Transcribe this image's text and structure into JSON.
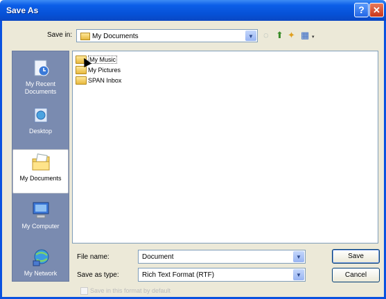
{
  "window": {
    "title": "Save As",
    "help_icon": "?",
    "close_icon": "✕"
  },
  "toolbar": {
    "save_in_label": "Save in:",
    "save_in_value": "My Documents",
    "back_icon": "back-icon",
    "up_icon": "up-folder-icon",
    "new_folder_icon": "new-folder-icon",
    "views_icon": "views-menu-icon",
    "back_glyph": "◌",
    "up_glyph": "⬆",
    "new_folder_glyph": "✦",
    "views_glyph": "▦"
  },
  "places": [
    {
      "label": "My Recent Documents",
      "icon": "recent-documents-icon"
    },
    {
      "label": "Desktop",
      "icon": "desktop-icon"
    },
    {
      "label": "My Documents",
      "icon": "my-documents-icon",
      "selected": true
    },
    {
      "label": "My Computer",
      "icon": "my-computer-icon"
    },
    {
      "label": "My Network",
      "icon": "my-network-icon"
    }
  ],
  "files": [
    {
      "name": "My Music"
    },
    {
      "name": "My Pictures"
    },
    {
      "name": "SPAN Inbox"
    }
  ],
  "form": {
    "file_name_label": "File name:",
    "file_name_value": "Document",
    "save_as_type_label": "Save as type:",
    "save_as_type_value": "Rich Text Format (RTF)",
    "save_button": "Save",
    "cancel_button": "Cancel",
    "checkbox_label": "Save in this format by default"
  },
  "colors": {
    "titlebar": "#0b5ee8",
    "places_bar": "#7a8bb0",
    "dialog_bg": "#ece9d8"
  }
}
